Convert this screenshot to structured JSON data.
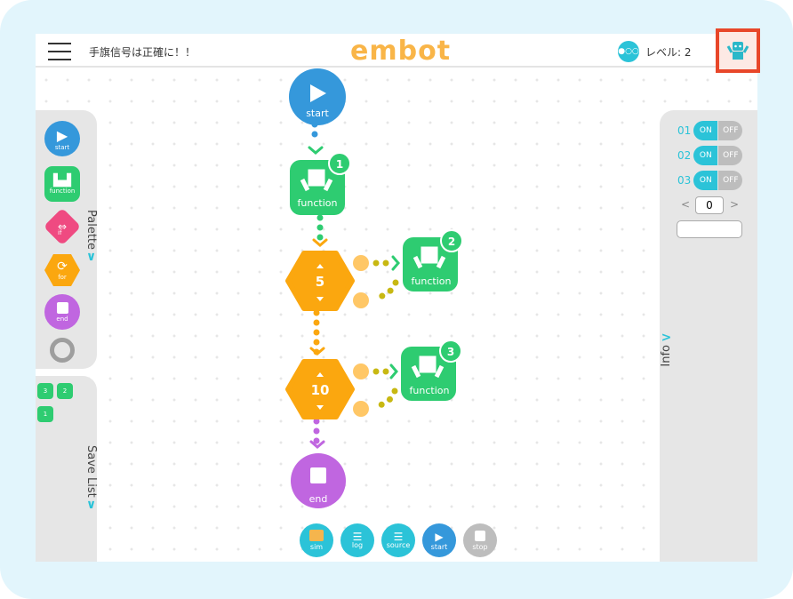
{
  "header": {
    "title": "手旗信号は正確に！！",
    "logo": "embot",
    "level_label": "レベル: 2",
    "level_icon": "●○○"
  },
  "palette": {
    "label": "Palette",
    "items": [
      {
        "label": "start"
      },
      {
        "label": "function"
      },
      {
        "label": "if"
      },
      {
        "label": "for"
      },
      {
        "label": "end"
      }
    ]
  },
  "save_list": {
    "label": "Save List",
    "items": [
      "3",
      "2",
      "1"
    ]
  },
  "info": {
    "label": "Info",
    "toggles": [
      {
        "id": "01",
        "on": "ON",
        "off": "OFF"
      },
      {
        "id": "02",
        "on": "ON",
        "off": "OFF"
      },
      {
        "id": "03",
        "on": "ON",
        "off": "OFF"
      }
    ],
    "counter": "0",
    "prev": "<",
    "next": ">",
    "text_value": ""
  },
  "flow": {
    "start": "start",
    "func1": {
      "label": "function",
      "badge": "1"
    },
    "loop1": {
      "count": "5"
    },
    "func2": {
      "label": "function",
      "badge": "2"
    },
    "loop2": {
      "count": "10"
    },
    "func3": {
      "label": "function",
      "badge": "3"
    },
    "end": "end"
  },
  "toolbar": {
    "sim": "sim",
    "log": "log",
    "source": "source",
    "start": "start",
    "stop": "stop"
  },
  "colors": {
    "start": "#3598db",
    "function": "#2ecc71",
    "if": "#ef4a81",
    "for": "#fba70f",
    "end": "#c066e0",
    "accent": "#2bc3d8",
    "highlight": "#e8472a"
  }
}
